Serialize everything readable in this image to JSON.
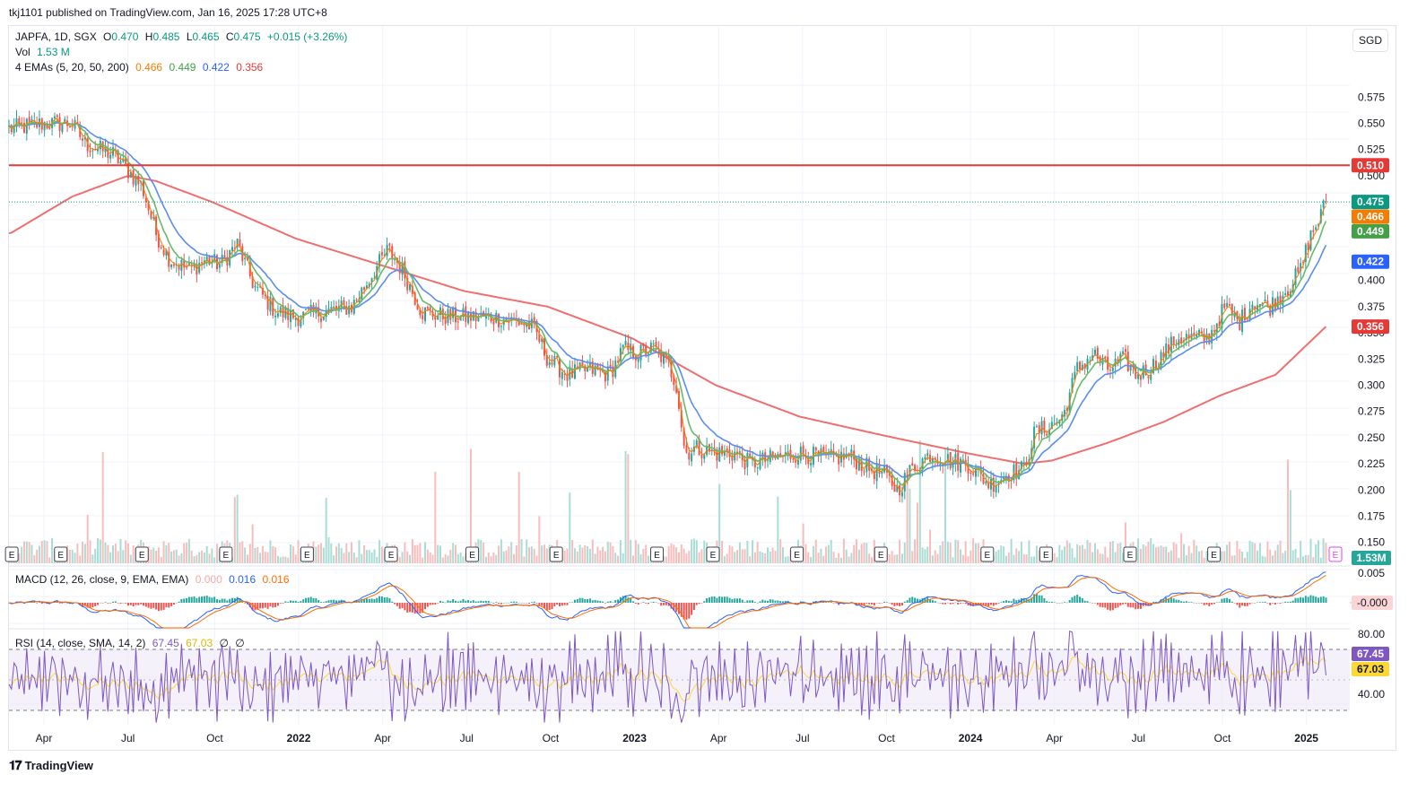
{
  "published": "tkj1101 published on TradingView.com, Jan 16, 2025 17:28 UTC+8",
  "currency": "SGD",
  "footer": {
    "brand": "TradingView"
  },
  "legend": {
    "symbol": "JAPFA, 1D, SGX",
    "o_label": "O",
    "o_value": "0.470",
    "h_label": "H",
    "h_value": "0.485",
    "l_label": "L",
    "l_value": "0.465",
    "c_label": "C",
    "c_value": "0.475",
    "change": "+0.015 (+3.26%)",
    "vol_label": "Vol",
    "vol_value": "1.53 M",
    "ema_label": "4 EMAs (5, 20, 50, 200)",
    "ema_values": [
      "0.466",
      "0.449",
      "0.422",
      "0.356"
    ],
    "macd_label": "MACD (12, 26, close, 9, EMA, EMA)",
    "macd_values": [
      "0.000",
      "0.016",
      "0.016"
    ],
    "rsi_label": "RSI (14, close, SMA, 14, 2)",
    "rsi_values": [
      "67.45",
      "67.03",
      "∅",
      "∅"
    ]
  },
  "colors": {
    "up": "#26a69a",
    "down": "#ef5350",
    "ema5": "#f57c00",
    "ema20": "#66bb6a",
    "ema50": "#5b8def",
    "ema200": "#ef6f6f",
    "resistance": "#e53935",
    "macd": "#2962ff",
    "signal": "#ff6d00",
    "rsi": "#7e57c2",
    "rsi_ma": "#fdd835"
  },
  "chart_data": {
    "type": "candlestick",
    "y_axis": {
      "ticks": [
        "0.575",
        "0.550",
        "0.525",
        "0.500",
        "0.400",
        "0.375",
        "0.350",
        "0.325",
        "0.300",
        "0.275",
        "0.250",
        "0.225",
        "0.200",
        "0.175",
        "0.150"
      ],
      "range": [
        0.13,
        0.595
      ]
    },
    "x_axis": {
      "ticks": [
        {
          "label": "Apr",
          "t": 0.0
        },
        {
          "label": "Jul",
          "t": 3.0
        },
        {
          "label": "Oct",
          "t": 6.1
        },
        {
          "label": "2022",
          "t": 9.1,
          "bold": true
        },
        {
          "label": "Apr",
          "t": 12.1
        },
        {
          "label": "Jul",
          "t": 15.1
        },
        {
          "label": "Oct",
          "t": 18.1
        },
        {
          "label": "2023",
          "t": 21.1,
          "bold": true
        },
        {
          "label": "Apr",
          "t": 24.1
        },
        {
          "label": "Jul",
          "t": 27.1
        },
        {
          "label": "Oct",
          "t": 30.1
        },
        {
          "label": "2024",
          "t": 33.1,
          "bold": true
        },
        {
          "label": "Apr",
          "t": 36.1
        },
        {
          "label": "Jul",
          "t": 39.1
        },
        {
          "label": "Oct",
          "t": 42.1
        },
        {
          "label": "2025",
          "t": 45.1,
          "bold": true
        }
      ],
      "range_months": [
        -1.25,
        46.65
      ]
    },
    "price_path": [
      [
        -1.2,
        0.545
      ],
      [
        0.0,
        0.55
      ],
      [
        1.0,
        0.55
      ],
      [
        1.5,
        0.53
      ],
      [
        2.5,
        0.52
      ],
      [
        3.0,
        0.505
      ],
      [
        3.5,
        0.49
      ],
      [
        4.0,
        0.445
      ],
      [
        4.5,
        0.42
      ],
      [
        5.2,
        0.41
      ],
      [
        5.8,
        0.42
      ],
      [
        6.3,
        0.415
      ],
      [
        6.9,
        0.435
      ],
      [
        7.5,
        0.395
      ],
      [
        8.3,
        0.37
      ],
      [
        9.0,
        0.365
      ],
      [
        10.0,
        0.37
      ],
      [
        11.0,
        0.375
      ],
      [
        12.3,
        0.43
      ],
      [
        12.8,
        0.41
      ],
      [
        13.5,
        0.37
      ],
      [
        14.5,
        0.365
      ],
      [
        15.2,
        0.365
      ],
      [
        16.0,
        0.365
      ],
      [
        17.0,
        0.36
      ],
      [
        17.5,
        0.355
      ],
      [
        18.0,
        0.325
      ],
      [
        18.7,
        0.31
      ],
      [
        19.5,
        0.315
      ],
      [
        20.2,
        0.31
      ],
      [
        20.7,
        0.335
      ],
      [
        21.2,
        0.33
      ],
      [
        21.8,
        0.335
      ],
      [
        22.3,
        0.32
      ],
      [
        22.6,
        0.3
      ],
      [
        22.9,
        0.235
      ],
      [
        23.3,
        0.24
      ],
      [
        24.0,
        0.235
      ],
      [
        24.7,
        0.235
      ],
      [
        25.2,
        0.225
      ],
      [
        26.0,
        0.23
      ],
      [
        27.0,
        0.235
      ],
      [
        28.0,
        0.23
      ],
      [
        28.8,
        0.232
      ],
      [
        29.5,
        0.22
      ],
      [
        30.0,
        0.215
      ],
      [
        30.5,
        0.2
      ],
      [
        31.0,
        0.22
      ],
      [
        31.7,
        0.235
      ],
      [
        32.3,
        0.228
      ],
      [
        33.0,
        0.225
      ],
      [
        33.8,
        0.205
      ],
      [
        34.4,
        0.215
      ],
      [
        35.0,
        0.22
      ],
      [
        35.4,
        0.255
      ],
      [
        35.9,
        0.26
      ],
      [
        36.4,
        0.27
      ],
      [
        36.9,
        0.315
      ],
      [
        37.5,
        0.33
      ],
      [
        38.0,
        0.315
      ],
      [
        38.6,
        0.325
      ],
      [
        39.0,
        0.31
      ],
      [
        39.5,
        0.315
      ],
      [
        40.0,
        0.33
      ],
      [
        40.5,
        0.345
      ],
      [
        41.0,
        0.345
      ],
      [
        41.6,
        0.345
      ],
      [
        42.2,
        0.375
      ],
      [
        42.7,
        0.36
      ],
      [
        43.2,
        0.38
      ],
      [
        43.8,
        0.375
      ],
      [
        44.5,
        0.395
      ],
      [
        44.9,
        0.41
      ],
      [
        45.2,
        0.44
      ],
      [
        45.5,
        0.455
      ],
      [
        45.8,
        0.475
      ]
    ],
    "ema200_path": [
      [
        -1.2,
        0.445
      ],
      [
        1.0,
        0.48
      ],
      [
        3.0,
        0.5
      ],
      [
        4.0,
        0.495
      ],
      [
        6.0,
        0.475
      ],
      [
        9.0,
        0.44
      ],
      [
        12.0,
        0.415
      ],
      [
        15.0,
        0.39
      ],
      [
        18.0,
        0.375
      ],
      [
        21.0,
        0.345
      ],
      [
        24.0,
        0.3
      ],
      [
        27.0,
        0.27
      ],
      [
        30.0,
        0.252
      ],
      [
        33.0,
        0.235
      ],
      [
        35.0,
        0.225
      ],
      [
        36.0,
        0.228
      ],
      [
        38.0,
        0.245
      ],
      [
        40.0,
        0.265
      ],
      [
        42.0,
        0.29
      ],
      [
        44.0,
        0.31
      ],
      [
        45.8,
        0.356
      ]
    ],
    "resistance_level": 0.51,
    "last_price": 0.475,
    "price_labels": [
      {
        "value": "0.510",
        "price": 0.51,
        "bg": "#e53935"
      },
      {
        "value": "0.475",
        "price": 0.475,
        "bg": "#089981"
      },
      {
        "value": "0.466",
        "price": 0.461,
        "bg": "#f57c00"
      },
      {
        "value": "0.449",
        "price": 0.447,
        "bg": "#43a047"
      },
      {
        "value": "0.422",
        "price": 0.418,
        "bg": "#2962ff"
      },
      {
        "value": "0.356",
        "price": 0.356,
        "bg": "#e53935"
      }
    ],
    "volume_label": "1.53M",
    "earnings_marker": "E",
    "earnings_months": [
      -1.15,
      0.6,
      3.5,
      6.5,
      9.4,
      12.4,
      15.3,
      18.3,
      21.9,
      23.9,
      26.9,
      29.9,
      33.7,
      35.8,
      38.8,
      41.8
    ],
    "macd_axis_labels": [
      "0.005",
      "-0.000"
    ],
    "rsi_axis_labels": [
      "80.00",
      "40.00"
    ],
    "rsi_bands": [
      70,
      30,
      50
    ],
    "rsi_last": "67.45",
    "rsi_ma_last": "67.03"
  }
}
